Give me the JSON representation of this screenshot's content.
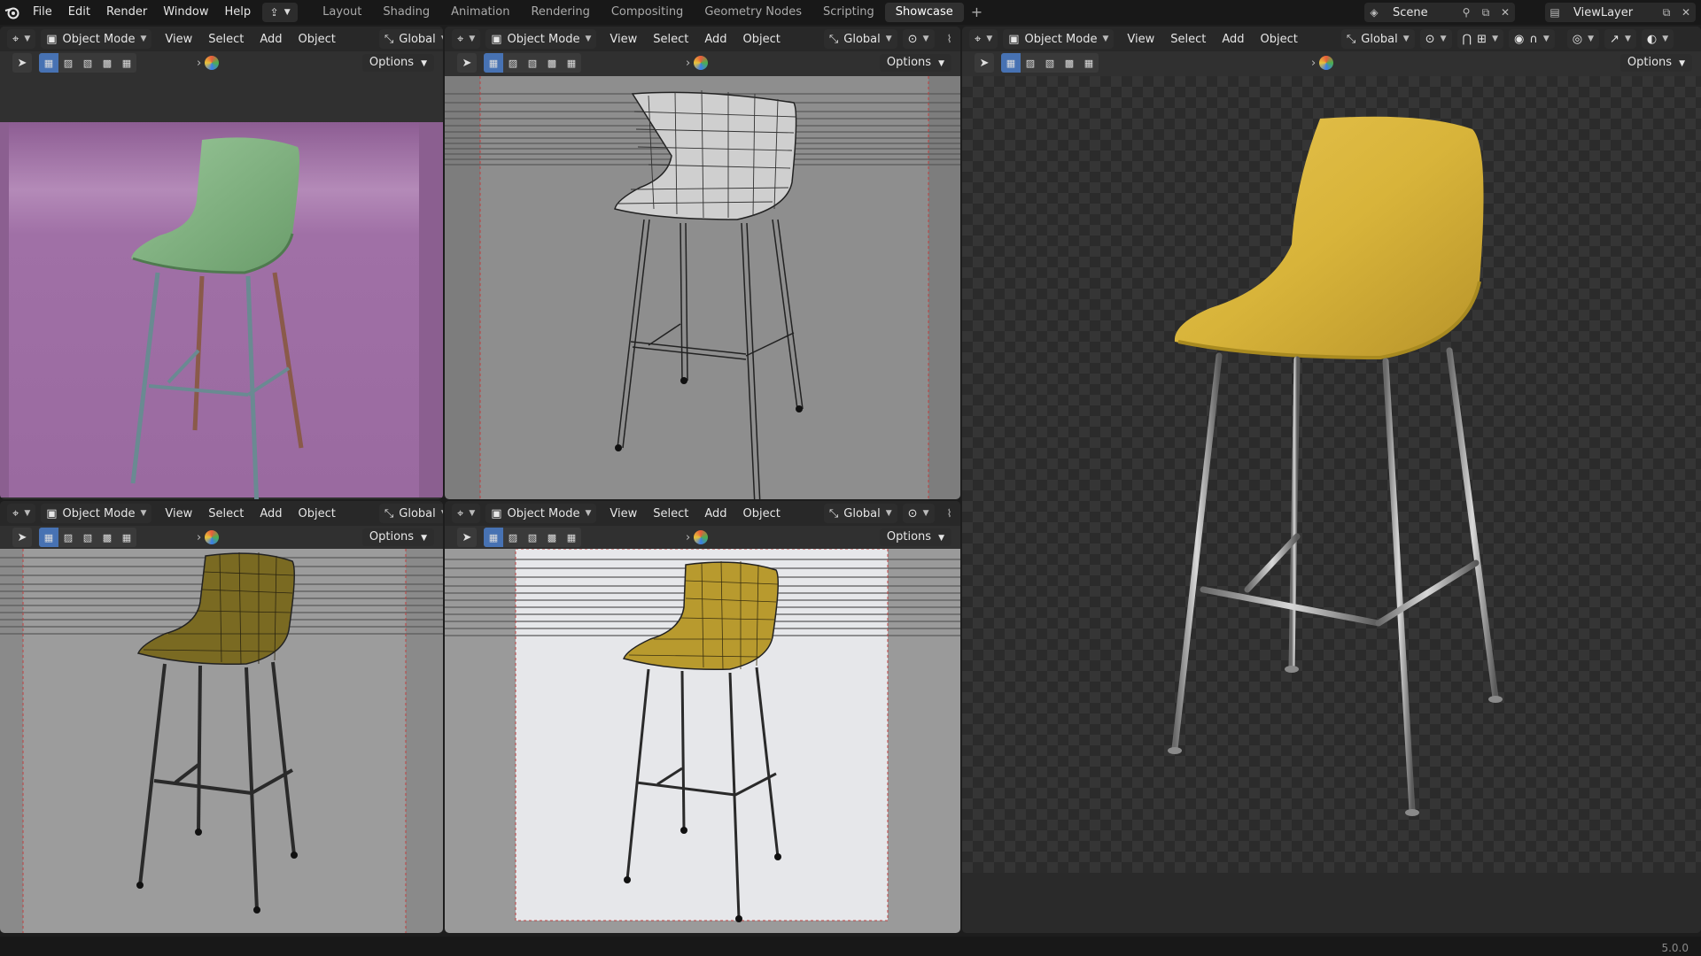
{
  "menus": [
    "File",
    "Edit",
    "Render",
    "Window",
    "Help"
  ],
  "workspaces": [
    {
      "label": "Layout",
      "active": false
    },
    {
      "label": "Shading",
      "active": false
    },
    {
      "label": "Animation",
      "active": false
    },
    {
      "label": "Rendering",
      "active": false
    },
    {
      "label": "Compositing",
      "active": false
    },
    {
      "label": "Geometry Nodes",
      "active": false
    },
    {
      "label": "Scripting",
      "active": false
    },
    {
      "label": "Showcase",
      "active": true
    }
  ],
  "workspace_add": "+",
  "scene": "Scene",
  "view_layer": "ViewLayer",
  "version": "5.0.0",
  "viewport": {
    "mode": "Object Mode",
    "menus": [
      "View",
      "Select",
      "Add",
      "Object"
    ],
    "orientation": "Global",
    "options": "Options"
  },
  "colors": {
    "seat_green": "#7fae7f",
    "seat_yellow": "#d8b43a",
    "seat_olive": "#8a7a2a",
    "bg_purple": "#9a6aa0",
    "accent": "#4772b3"
  }
}
